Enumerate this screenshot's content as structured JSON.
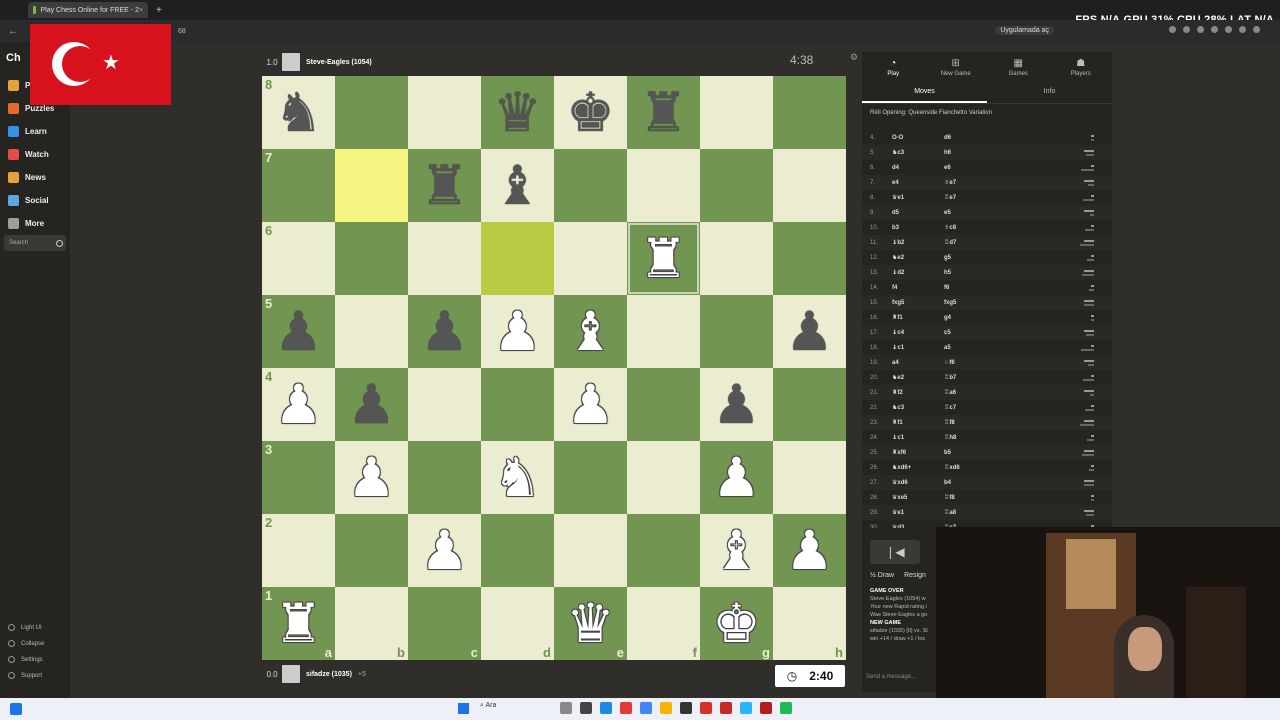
{
  "browser": {
    "tab_title": "Play Chess Online for FREE - 2",
    "tab_close": "×",
    "new_tab": "+",
    "url": "68",
    "app_button": "Uygulamada aç"
  },
  "hud": {
    "fps_label": "FPS",
    "fps": "N/A",
    "gpu_label": "GPU",
    "gpu": "31%",
    "cpu_label": "CPU",
    "cpu": "28%",
    "lat_label": "LAT",
    "lat": "N/A"
  },
  "sidebar": {
    "logo": "Ch",
    "items": [
      {
        "label": "P",
        "color": "#e2a33a"
      },
      {
        "label": "Puzzles",
        "color": "#e26b2a"
      },
      {
        "label": "Learn",
        "color": "#3692e7"
      },
      {
        "label": "Watch",
        "color": "#e44b4b"
      },
      {
        "label": "News",
        "color": "#e8a23a"
      },
      {
        "label": "Social",
        "color": "#5fa6df"
      },
      {
        "label": "More",
        "color": "#9e9e9e"
      }
    ],
    "search_placeholder": "Search",
    "bottom": [
      "Light UI",
      "Collapse",
      "Settings",
      "Support"
    ]
  },
  "top_player": {
    "score": "1.0",
    "name": "Steve-Eagles (1054)",
    "clock": "4:38"
  },
  "bottom_player": {
    "score": "0.0",
    "name": "sifadze (1035)",
    "caps": "+5",
    "clock": "2:40"
  },
  "board": {
    "ranks": [
      "8",
      "7",
      "6",
      "5",
      "4",
      "3",
      "2",
      "1"
    ],
    "files": [
      "a",
      "b",
      "c",
      "d",
      "e",
      "f",
      "g",
      "h"
    ],
    "rows": [
      [
        "bN",
        "",
        "",
        "bQ",
        "bK",
        "bR",
        "",
        ""
      ],
      [
        "",
        "",
        "bR",
        "bB",
        "",
        "",
        "",
        ""
      ],
      [
        "",
        "",
        "",
        "",
        "",
        "wR",
        "",
        ""
      ],
      [
        "bP",
        "",
        "bP",
        "wP",
        "wB",
        "",
        "",
        "bP"
      ],
      [
        "wP",
        "bP",
        "",
        "",
        "wP",
        "",
        "bP",
        ""
      ],
      [
        "",
        "wP",
        "",
        "wN",
        "",
        "",
        "wP",
        ""
      ],
      [
        "",
        "",
        "wP",
        "",
        "",
        "",
        "wB",
        "wP"
      ],
      [
        "wR",
        "",
        "",
        "",
        "wQ",
        "",
        "wK",
        ""
      ]
    ],
    "highlights": [
      [
        1,
        1
      ],
      [
        2,
        3
      ]
    ]
  },
  "panel": {
    "tabs": [
      "Play",
      "New Game",
      "Games",
      "Players"
    ],
    "subtabs": [
      "Moves",
      "Info"
    ],
    "opening": "Réti Opening: Queenside Fianchetto Variation",
    "moves": [
      {
        "n": "4.",
        "w": "O-O",
        "b": "d6"
      },
      {
        "n": "5.",
        "w": "♞c3",
        "b": "h6"
      },
      {
        "n": "6.",
        "w": "d4",
        "b": "e6"
      },
      {
        "n": "7.",
        "w": "e4",
        "b": "♗e7"
      },
      {
        "n": "8.",
        "w": "♛e1",
        "b": "♖e7"
      },
      {
        "n": "9.",
        "w": "d5",
        "b": "e5"
      },
      {
        "n": "10.",
        "w": "b3",
        "b": "♗c8"
      },
      {
        "n": "11.",
        "w": "♝b2",
        "b": "♖d7"
      },
      {
        "n": "12.",
        "w": "♞e2",
        "b": "g5"
      },
      {
        "n": "13.",
        "w": "♝d2",
        "b": "h5"
      },
      {
        "n": "14.",
        "w": "f4",
        "b": "f6"
      },
      {
        "n": "15.",
        "w": "fxg5",
        "b": "fxg5"
      },
      {
        "n": "16.",
        "w": "♜f1",
        "b": "g4"
      },
      {
        "n": "17.",
        "w": "♝c4",
        "b": "c5"
      },
      {
        "n": "18.",
        "w": "♝c1",
        "b": "a5"
      },
      {
        "n": "19.",
        "w": "a4",
        "b": "♘f6"
      },
      {
        "n": "20.",
        "w": "♞e2",
        "b": "♖b7"
      },
      {
        "n": "21.",
        "w": "♜f2",
        "b": "♖a6"
      },
      {
        "n": "22.",
        "w": "♞c3",
        "b": "♖c7"
      },
      {
        "n": "23.",
        "w": "♜f1",
        "b": "♖f8"
      },
      {
        "n": "24.",
        "w": "♝c1",
        "b": "♖h8"
      },
      {
        "n": "25.",
        "w": "♜xf6",
        "b": "b5"
      },
      {
        "n": "26.",
        "w": "♞xd6+",
        "b": "♖xd6"
      },
      {
        "n": "27.",
        "w": "♛xd6",
        "b": "b4"
      },
      {
        "n": "28.",
        "w": "♛xe5",
        "b": "♖f8"
      },
      {
        "n": "29.",
        "w": "♛e1",
        "b": "♖a8"
      },
      {
        "n": "30.",
        "w": "♛d3",
        "b": "♖c7"
      }
    ],
    "nav_first": "❘◀",
    "draw": "½ Draw",
    "resign": "Resign",
    "log": [
      {
        "b": "GAME OVER",
        "t": ""
      },
      {
        "b": "",
        "t": "Steve-Eagles (1054) w"
      },
      {
        "b": "",
        "t": "Your new Rapid rating i"
      },
      {
        "b": "",
        "t": "Was Steve-Eagles a go"
      },
      {
        "b": "NEW GAME",
        "t": ""
      },
      {
        "b": "",
        "t": "sifadze (1035) [0] vs. St"
      },
      {
        "b": "",
        "t": "win +14 / draw +1 / los"
      }
    ],
    "msg_placeholder": "Send a message..."
  },
  "taskbar": {
    "search": "Ara"
  }
}
